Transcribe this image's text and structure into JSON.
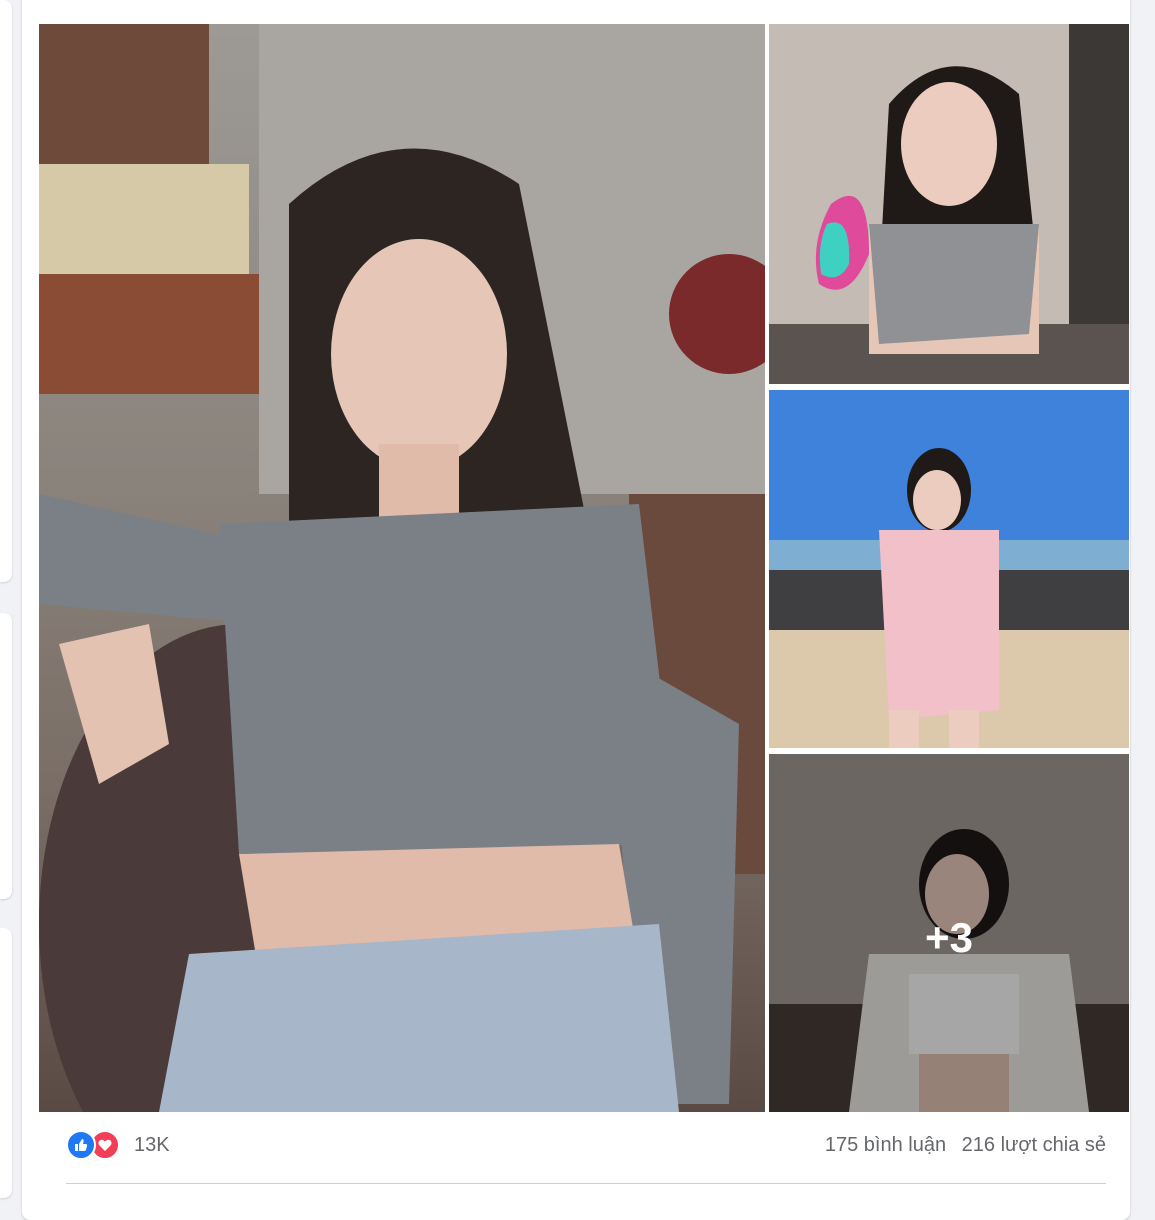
{
  "post": {
    "photos": [
      {
        "description": "main-photo"
      },
      {
        "description": "side-photo-1"
      },
      {
        "description": "side-photo-2"
      },
      {
        "description": "side-photo-3"
      }
    ],
    "more_photos_label": "+3",
    "stats": {
      "reaction_count": "13K",
      "comments": "175 bình luận",
      "shares": "216 lượt chia sẻ"
    },
    "reaction_icons": [
      "like-icon",
      "love-icon"
    ],
    "colors": {
      "like": "#2078f4",
      "love": "#f33e58",
      "secondary_text": "#65676b"
    }
  }
}
